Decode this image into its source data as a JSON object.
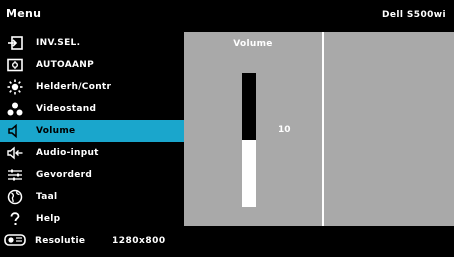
{
  "header": {
    "title": "Menu",
    "model": "Dell S500wi"
  },
  "menu": {
    "items": [
      {
        "label": "INV.SEL.",
        "icon": "input-select-icon"
      },
      {
        "label": "AUTOAANP",
        "icon": "auto-adjust-icon"
      },
      {
        "label": "Helderh/Contr",
        "icon": "brightness-icon"
      },
      {
        "label": "Videostand",
        "icon": "video-mode-icon"
      },
      {
        "label": "Volume",
        "icon": "speaker-icon",
        "selected": true
      },
      {
        "label": "Audio-input",
        "icon": "audio-input-icon"
      },
      {
        "label": "Gevorderd",
        "icon": "advanced-settings-icon"
      },
      {
        "label": "Taal",
        "icon": "globe-icon"
      },
      {
        "label": "Help",
        "icon": "help-icon"
      }
    ]
  },
  "panel": {
    "title": "Volume",
    "value": "10",
    "level_fraction": 0.5
  },
  "status": {
    "label": "Resolutie",
    "value": "1280x800",
    "icon": "projector-icon"
  },
  "colors": {
    "accent": "#1aa6cc",
    "panel_bg": "#a9a9a9",
    "background": "#000000"
  }
}
